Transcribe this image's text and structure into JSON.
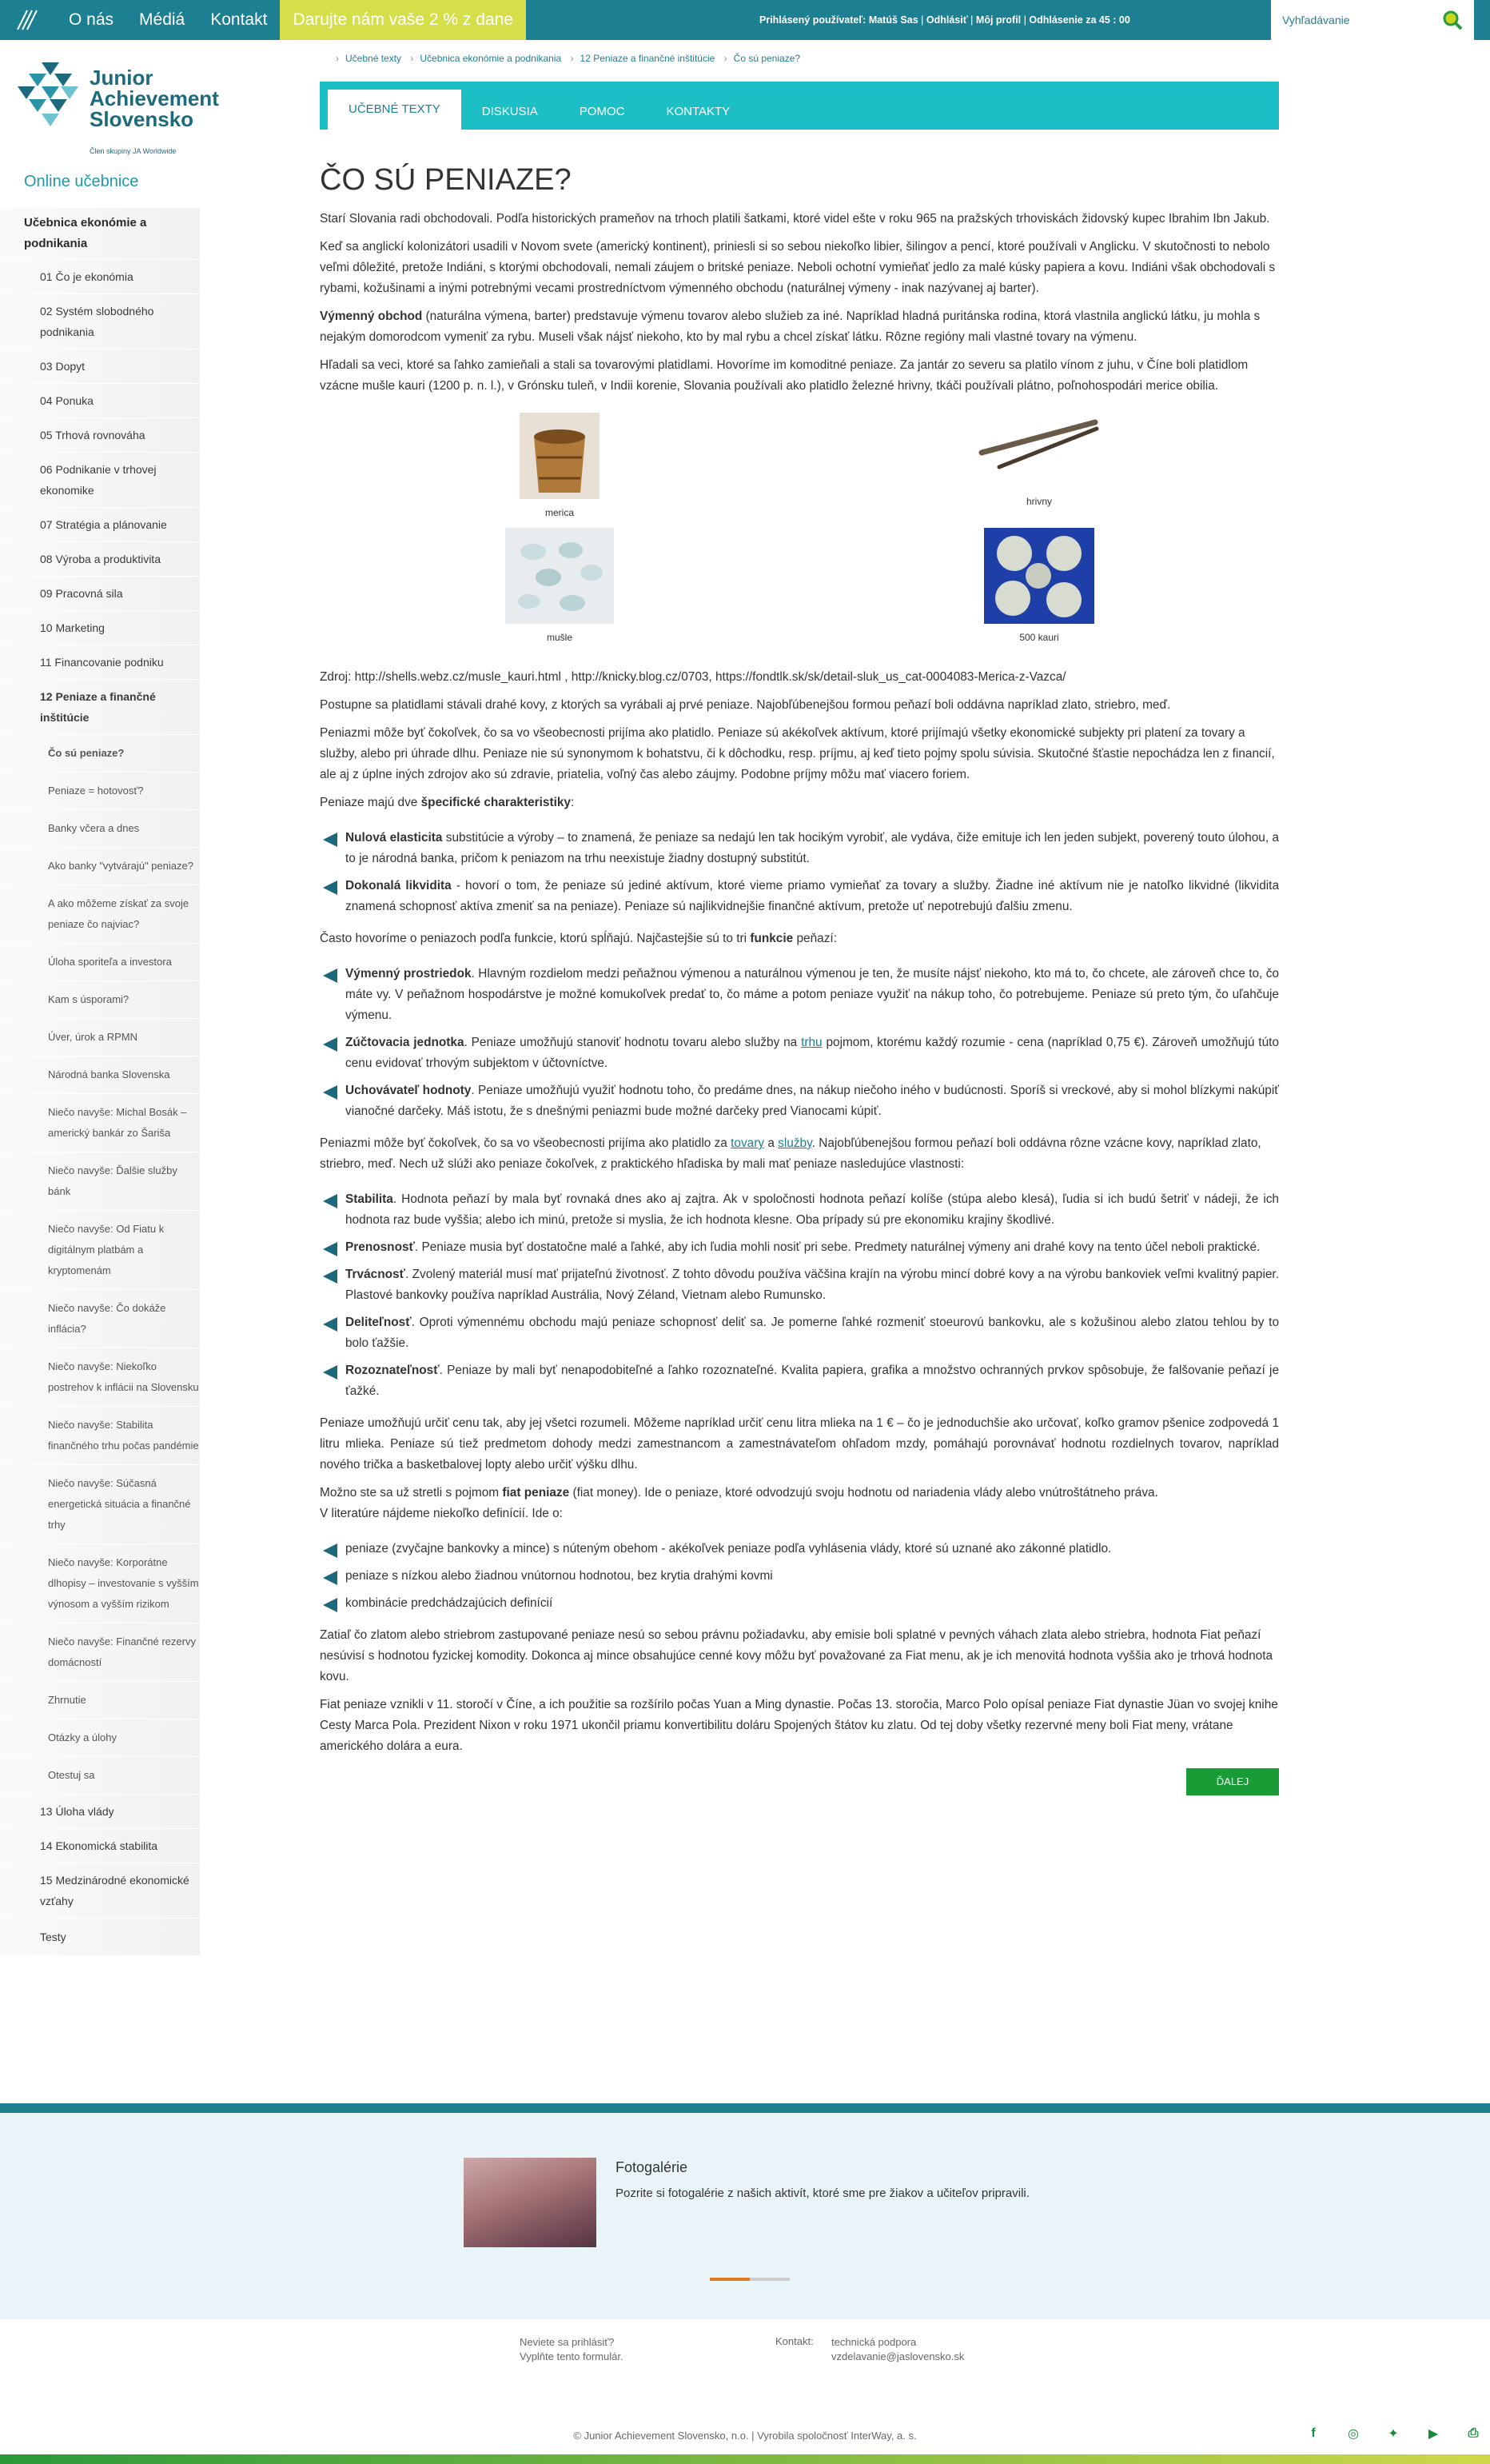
{
  "topbar": {
    "nav": [
      "O nás",
      "Médiá",
      "Kontakt"
    ],
    "promo": "Darujte nám vaše 2 % z dane",
    "user_label": "Prihlásený používateľ:",
    "user_name": "Matúš Sas",
    "logout": "Odhlásiť",
    "profile": "Môj profil",
    "timer_label": "Odhlásenie za",
    "timer": "45 : 00",
    "search_placeholder": "Vyhľadávanie"
  },
  "logo": {
    "line1": "Junior",
    "line2": "Achievement",
    "line3": "Slovensko",
    "sub": "Člen skupiny JA Worldwide"
  },
  "sidebar": {
    "title": "Online učebnice",
    "items": [
      {
        "t": "Učebnica ekonómie a podnikania",
        "k": "top"
      },
      {
        "t": "01 Čo je ekonómia",
        "k": "ch"
      },
      {
        "t": "02 Systém slobodného podnikania",
        "k": "ch"
      },
      {
        "t": "03 Dopyt",
        "k": "ch"
      },
      {
        "t": "04 Ponuka",
        "k": "ch"
      },
      {
        "t": "05 Trhová rovnováha",
        "k": "ch"
      },
      {
        "t": "06 Podnikanie v trhovej ekonomike",
        "k": "ch"
      },
      {
        "t": "07 Stratégia a plánovanie",
        "k": "ch"
      },
      {
        "t": "08 Výroba a produktivita",
        "k": "ch"
      },
      {
        "t": "09 Pracovná sila",
        "k": "ch"
      },
      {
        "t": "10 Marketing",
        "k": "ch"
      },
      {
        "t": "11 Financovanie podniku",
        "k": "ch"
      },
      {
        "t": "12 Peniaze a finančné inštitúcie",
        "k": "ch act"
      },
      {
        "t": "Čo sú peniaze?",
        "k": "gc cur"
      },
      {
        "t": "Peniaze = hotovosť?",
        "k": "gc"
      },
      {
        "t": "Banky včera a dnes",
        "k": "gc"
      },
      {
        "t": "Ako banky \"vytvárajú\" peniaze?",
        "k": "gc"
      },
      {
        "t": "A ako môžeme získať za svoje peniaze čo najviac?",
        "k": "gc"
      },
      {
        "t": "Úloha sporiteľa a investora",
        "k": "gc"
      },
      {
        "t": "Kam s úsporami?",
        "k": "gc"
      },
      {
        "t": "Úver, úrok a RPMN",
        "k": "gc"
      },
      {
        "t": "Národná banka Slovenska",
        "k": "gc"
      },
      {
        "t": "Niečo navyše: Michal Bosák – americký bankár zo Šariša",
        "k": "gc"
      },
      {
        "t": "Niečo navyše: Ďalšie služby bánk",
        "k": "gc"
      },
      {
        "t": "Niečo navyše: Od Fiatu k digitálnym platbám a kryptomenám",
        "k": "gc"
      },
      {
        "t": "Niečo navyše: Čo dokáže inflácia?",
        "k": "gc"
      },
      {
        "t": "Niečo navyše: Niekoľko postrehov k inflácii na Slovensku",
        "k": "gc"
      },
      {
        "t": "Niečo navyše: Stabilita finančného trhu počas pandémie",
        "k": "gc"
      },
      {
        "t": "Niečo navyše: Súčasná energetická situácia a finančné trhy",
        "k": "gc"
      },
      {
        "t": "Niečo navyše: Korporátne dlhopisy – investovanie s vyšším výnosom a vyšším rizikom",
        "k": "gc"
      },
      {
        "t": "Niečo navyše: Finančné rezervy domácností",
        "k": "gc"
      },
      {
        "t": "Zhrnutie",
        "k": "gc"
      },
      {
        "t": "Otázky a úlohy",
        "k": "gc"
      },
      {
        "t": "Otestuj sa",
        "k": "gc"
      },
      {
        "t": "13 Úloha vlády",
        "k": "ch"
      },
      {
        "t": "14 Ekonomická stabilita",
        "k": "ch"
      },
      {
        "t": "15 Medzinárodné ekonomické vzťahy",
        "k": "ch"
      },
      {
        "t": "Testy",
        "k": "top-plain"
      }
    ]
  },
  "crumbs": [
    "Učebné texty",
    "Učebnica ekonómie a podnikania",
    "12 Peniaze a finančné inštitúcie",
    "Čo sú peniaze?"
  ],
  "tabs": [
    "UČEBNÉ TEXTY",
    "DISKUSIA",
    "POMOC",
    "KONTAKTY"
  ],
  "title": "ČO SÚ PENIAZE?",
  "p1": "Starí Slovania radi obchodovali. Podľa historických prameňov na trhoch platili šatkami, ktoré videl ešte v roku 965 na pražských trhoviskách židovský kupec Ibrahim Ibn Jakub.",
  "p2": "Keď sa anglickí kolonizátori usadili v Novom svete (americký kontinent), priniesli si so sebou niekoľko libier, šilingov a pencí, ktoré používali v Anglicku. V skutočnosti to nebolo veľmi dôležité, pretože Indiáni, s ktorými obchodovali, nemali záujem o britské peniaze. Neboli ochotní vymieňať jedlo za malé kúsky papiera a kovu. Indiáni však obchodovali s rybami, kožušinami a inými potrebnými vecami prostredníctvom výmenného obchodu (naturálnej výmeny - inak nazývanej aj barter).",
  "p3_b": "Výmenný obchod",
  "p3": " (naturálna výmena, barter) predstavuje výmenu tovarov alebo služieb za iné. Napríklad hladná puritánska rodina, ktorá vlastnila anglickú látku, ju mohla s nejakým domorodcom vymeniť za rybu. Museli však nájsť niekoho, kto by mal rybu a chcel získať látku. Rôzne regióny mali vlastné tovary na výmenu.",
  "p4": "Hľadali sa veci, ktoré sa ľahko zamieňali a stali sa tovarovými platidlami. Hovoríme im komoditné peniaze. Za jantár zo severu sa platilo vínom z juhu, v Číne boli platidlom vzácne mušle kauri (1200 p. n. l.), v Grónsku tuleň, v Indii korenie, Slovania používali ako platidlo železné hrivny, tkáči používali plátno, poľnohospodári merice obilia.",
  "images": [
    {
      "cap": "merica",
      "icon": "wooden-measure-image"
    },
    {
      "cap": "hrivny",
      "icon": "iron-bars-image"
    },
    {
      "cap": "mušle",
      "icon": "shells-image"
    },
    {
      "cap": "500 kauri",
      "icon": "kauri-image"
    }
  ],
  "source": "Zdroj: http://shells.webz.cz/musle_kauri.html , http://knicky.blog.cz/0703, https://fondtlk.sk/sk/detail-sluk_us_cat-0004083-Merica-z-Vazca/",
  "p5": "Postupne sa platidlami stávali drahé kovy, z ktorých sa vyrábali aj prvé peniaze. Najobľúbenejšou formou peňazí boli oddávna napríklad zlato, striebro, meď.",
  "p6": "Peniazmi môže byť čokoľvek, čo sa vo všeobecnosti prijíma ako platidlo. Peniaze sú akékoľvek aktívum, ktoré prijímajú všetky ekonomické subjekty pri platení za tovary a služby, alebo pri úhrade dlhu. Peniaze nie sú synonymom k bohatstvu, či k dôchodku, resp. príjmu, aj keď tieto pojmy spolu súvisia. Skutočné šťastie nepochádza len z financií, ale aj z úplne iných zdrojov ako sú zdravie, priatelia, voľný čas alebo záujmy. Podobne príjmy môžu mať viacero foriem.",
  "p7a": "Peniaze majú dve ",
  "p7b": "špecifické charakteristiky",
  "p7c": ":",
  "list1": [
    {
      "b": "Nulová elasticita",
      "t": " substitúcie a výroby – to znamená, že peniaze sa nedajú len tak hocikým vyrobiť, ale vydáva, čiže emituje ich len jeden subjekt, poverený touto úlohou, a to je národná banka, pričom k peniazom na trhu neexistuje žiadny dostupný substitút."
    },
    {
      "b": "Dokonalá likvidita",
      "t": " - hovorí o tom, že peniaze sú jediné aktívum, ktoré vieme priamo vymieňať za tovary a služby. Žiadne iné aktívum nie je natoľko likvidné (likvidita znamená schopnosť aktíva zmeniť sa na peniaze). Peniaze sú najlikvidnejšie finančné aktívum, pretože uť nepotrebujú ďalšiu zmenu."
    }
  ],
  "p8a": "Často hovoríme o peniazoch podľa funkcie, ktorú spĺňajú. Najčastejšie sú to tri ",
  "p8b": "funkcie",
  "p8c": " peňazí:",
  "list2": [
    {
      "b": "Výmenný prostriedok",
      "t": ". Hlavným rozdielom medzi peňažnou výmenou a naturálnou výmenou je ten, že musíte nájsť niekoho, kto má to, čo chcete, ale zároveň chce to, čo máte vy. V peňažnom hospodárstve je možné komukoľvek predať to, čo máme a potom peniaze využiť na nákup toho, čo potrebujeme. Peniaze sú preto tým, čo uľahčuje výmenu."
    },
    {
      "b": "Zúčtovacia jednotka",
      "t": ". Peniaze umožňujú stanoviť hodnotu tovaru alebo služby na ",
      "l": "trhu",
      "t2": " pojmom, ktorému každý rozumie  - cena (napríklad 0,75 €). Zároveň umožňujú túto cenu evidovať trhovým subjektom v účtovníctve."
    },
    {
      "b": "Uchovávateľ hodnoty",
      "t": ". Peniaze umožňujú využiť hodnotu toho, čo predáme dnes, na nákup niečoho iného v budúcnosti. Sporíš si vreckové, aby si mohol blízkymi nakúpiť vianočné darčeky. Máš istotu, že s  dnešnými peniazmi bude možné darčeky pred Vianocami kúpiť."
    }
  ],
  "p9a": "Peniazmi môže byť čokoľvek, čo sa vo všeobecnosti prijíma ako platidlo za ",
  "p9l1": "tovary",
  "p9m": " a ",
  "p9l2": "služby",
  "p9c": ". Najobľúbenejšou formou peňazí boli oddávna rôzne vzácne kovy, napríklad zlato, striebro, meď. Nech už slúži ako peniaze čokoľvek, z praktického hľadiska by mali mať peniaze nasledujúce vlastnosti:",
  "list3": [
    {
      "b": "Stabilita",
      "t": ". Hodnota peňazí by mala byť rovnaká dnes ako aj zajtra. Ak v spoločnosti hodnota peňazí kolíše (stúpa alebo klesá), ľudia si ich budú šetriť v nádeji, že ich hodnota raz bude vyššia; alebo ich minú, pretože si myslia, že ich hodnota klesne. Oba prípady sú pre ekonomiku krajiny škodlivé."
    },
    {
      "b": "Prenosnosť",
      "t": ". Peniaze musia byť dostatočne malé a ľahké, aby ich ľudia mohli nosiť pri sebe. Predmety naturálnej výmeny ani drahé kovy na tento účel neboli praktické."
    },
    {
      "b": "Trvácnosť",
      "t": ". Zvolený materiál musí mať prijateľnú životnosť. Z tohto dôvodu používa väčšina krajín na výrobu mincí dobré kovy a na výrobu bankoviek veľmi kvalitný papier. Plastové bankovky používa napríklad Austrália, Nový Zéland, Vietnam alebo Rumunsko."
    },
    {
      "b": "Deliteľnosť",
      "t": ". Oproti výmennému obchodu majú peniaze schopnosť deliť sa. Je pomerne ľahké rozmeniť stoeurovú bankovku, ale s kožušinou alebo zlatou tehlou by to bolo ťažšie."
    },
    {
      "b": "Rozoznateľnosť",
      "t": ". Peniaze by mali byť nenapodobiteľné a ľahko rozoznateľné. Kvalita papiera, grafika a množstvo ochranných prvkov spôsobuje, že falšovanie peňazí je ťažké."
    }
  ],
  "p10": "Peniaze umožňujú určiť cenu tak, aby jej všetci rozumeli. Môžeme napríklad určiť cenu litra mlieka na  1 € – čo je jednoduchšie ako určovať, koľko gramov pšenice zodpovedá 1 litru mlieka. Peniaze sú tiež predmetom dohody medzi zamestnancom a zamestnávateľom ohľadom mzdy, pomáhajú porovnávať hodnotu rozdielnych tovarov, napríklad nového trička a basketbalovej lopty alebo určiť výšku dlhu.",
  "p11a": "Možno ste sa už stretli s pojmom ",
  "p11b": "fiat peniaze",
  "p11c": " (fiat money). Ide o peniaze, ktoré odvodzujú svoju hodnotu od nariadenia vlády alebo vnútroštátneho práva.",
  "p11d": "V literatúre nájdeme niekoľko definícií. Ide o:",
  "list4": [
    "peniaze (zvyčajne bankovky a mince) s núteným obehom - akékoľvek  peniaze podľa vyhlásenia vlády, ktoré sú uznané ako zákonné platidlo.",
    "peniaze s nízkou alebo žiadnou vnútornou hodnotou, bez krytia drahými kovmi",
    "kombinácie predchádzajúcich definícií"
  ],
  "p12": "Zatiaľ čo zlatom alebo striebrom zastupované peniaze nesú so sebou právnu požiadavku, aby emisie boli splatné v pevných váhach zlata alebo striebra, hodnota Fiat peňazí nesúvisí s hodnotou fyzickej komodity. Dokonca aj mince obsahujúce cenné kovy môžu byť považované za Fiat menu, ak je ich menovitá hodnota vyššia ako je trhová hodnota kovu.",
  "p13": "Fiat peniaze vznikli v 11. storočí  v Číne, a ich použitie sa rozšírilo počas Yuan a Ming dynastie. Počas 13. storočia, Marco Polo opísal peniaze Fiat dynastie Jüan vo svojej knihe Cesty Marca Pola. Prezident Nixon v roku 1971 ukončil priamu konvertibilitu doláru Spojených štátov ku zlatu. Od tej doby všetky rezervné meny boli Fiat meny, vrátane amerického dolára a eura.",
  "next": "ĎALEJ",
  "gallery": {
    "title": "Fotogalérie",
    "text": "Pozrite si fotogalérie z našich aktivít, ktoré sme pre žiakov a učiteľov pripravili."
  },
  "footer": {
    "q": "Neviete sa prihlásiť?",
    "q2": "Vyplňte tento formulár.",
    "contact": "Kontakt:",
    "c1": "technická podpora",
    "c2": "vzdelavanie@jaslovensko.sk",
    "copy": "© Junior Achievement Slovensko, n.o. | Vyrobila spoločnosť InterWay, a. s."
  }
}
